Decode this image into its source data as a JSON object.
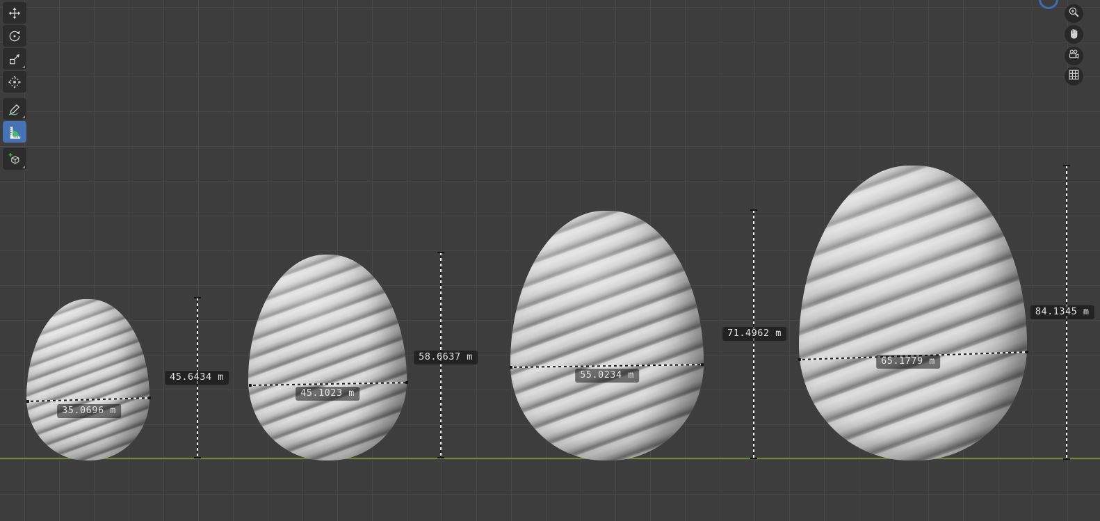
{
  "app": "blender-3d-viewport",
  "toolbar": {
    "active_color": "#4772b3",
    "tools": [
      {
        "name": "move",
        "icon": "move-icon",
        "active": false
      },
      {
        "name": "rotate",
        "icon": "rotate-icon",
        "active": false
      },
      {
        "name": "scale",
        "icon": "scale-icon",
        "active": false,
        "has_flyout": true
      },
      {
        "name": "transform",
        "icon": "transform-icon",
        "active": false
      },
      {
        "name": "annotate",
        "icon": "annotate-icon",
        "active": false,
        "has_flyout": true
      },
      {
        "name": "measure",
        "icon": "measure-icon",
        "active": true
      },
      {
        "name": "add-cube",
        "icon": "add-cube-icon",
        "active": false,
        "has_flyout": true
      }
    ]
  },
  "nav_gizmos": [
    {
      "name": "zoom",
      "icon": "zoom-in-icon"
    },
    {
      "name": "pan",
      "icon": "hand-icon"
    },
    {
      "name": "camera-view",
      "icon": "camera-icon"
    },
    {
      "name": "grid-toggle",
      "icon": "grid-icon"
    }
  ],
  "scene": {
    "unit": "m",
    "background": "#3d3d3d",
    "grid_color": "#484848",
    "ground_line_color": "#6c8a39",
    "objects": [
      {
        "name": "egg-1",
        "width_label": "35.0696 m",
        "height_label": "45.6434 m"
      },
      {
        "name": "egg-2",
        "width_label": "45.1023 m",
        "height_label": "58.6637 m"
      },
      {
        "name": "egg-3",
        "width_label": "55.0234 m",
        "height_label": "71.4962 m"
      },
      {
        "name": "egg-4",
        "width_label": "65.1779 m",
        "height_label": "84.1345 m"
      }
    ]
  }
}
